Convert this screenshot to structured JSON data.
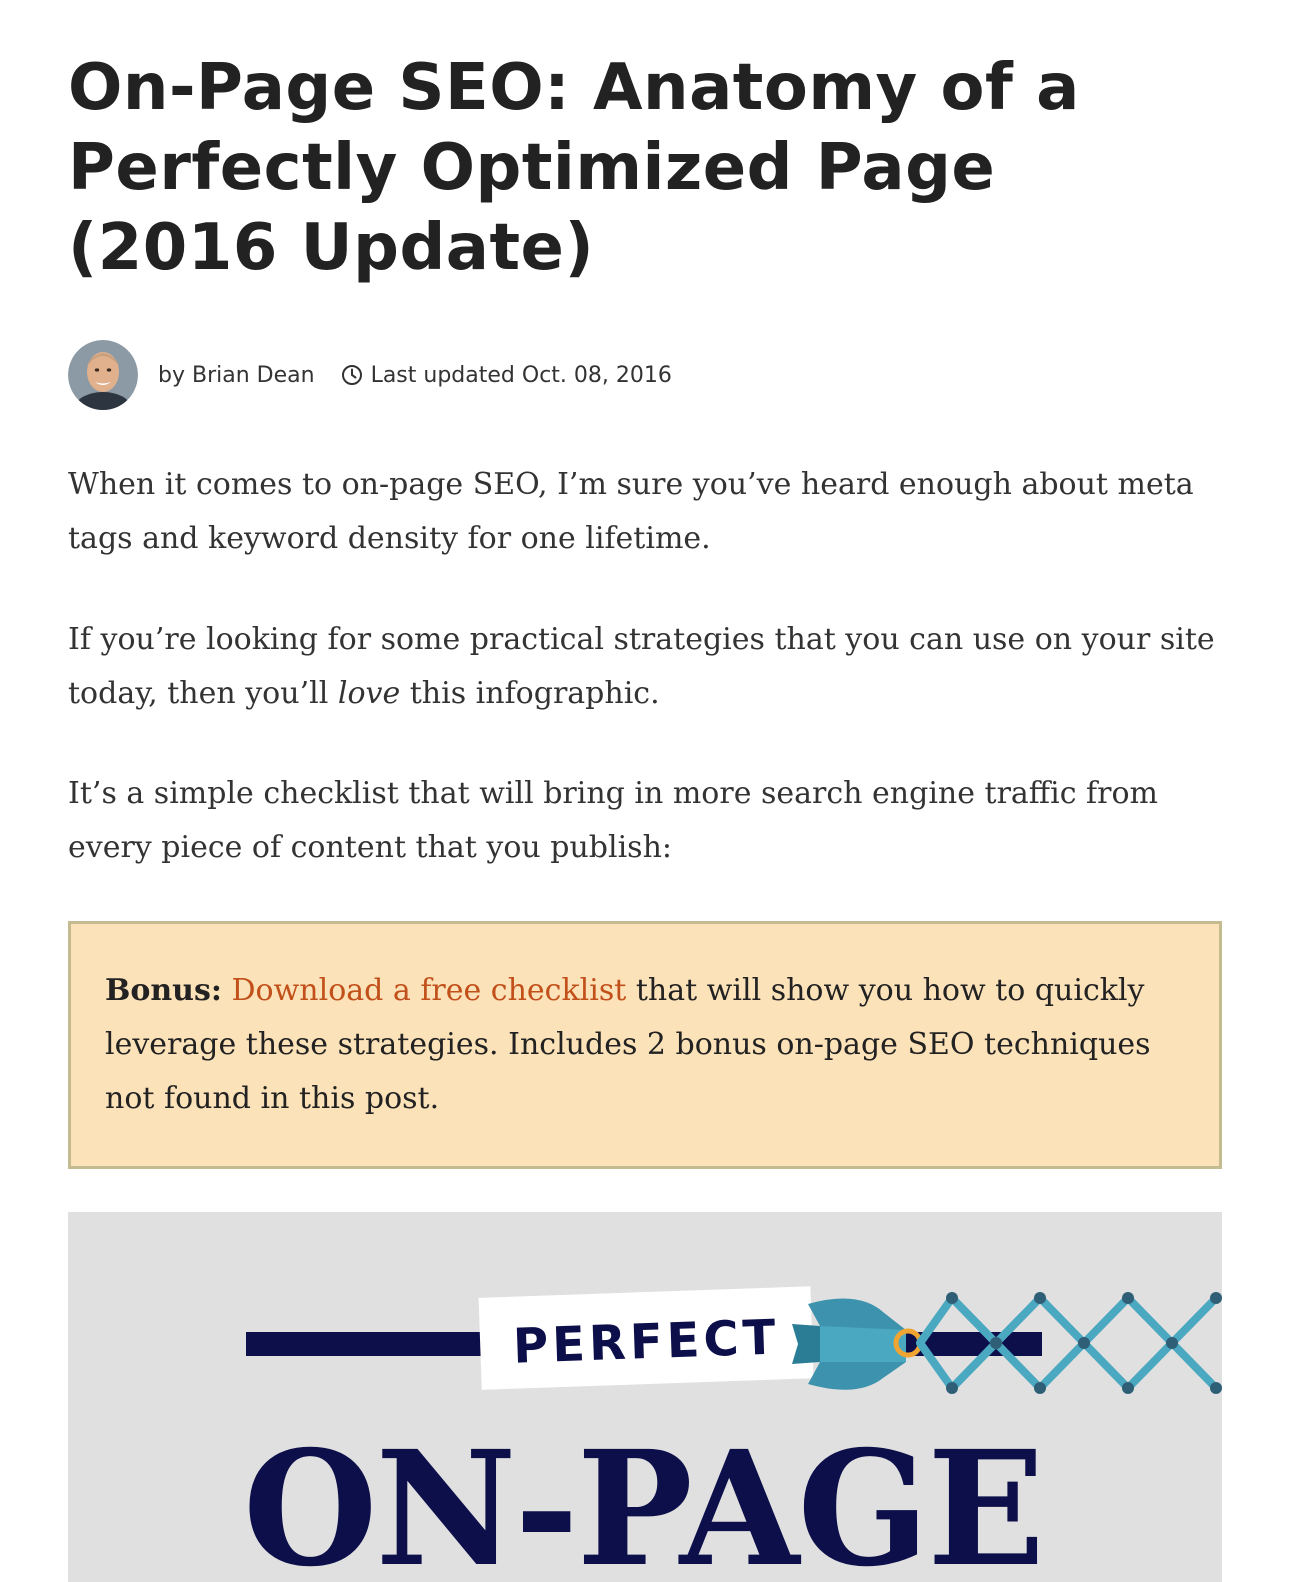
{
  "article": {
    "title": "On-Page SEO: Anatomy of a Perfectly Optimized Page (2016 Update)",
    "author_prefix": "by",
    "author_name": "Brian Dean",
    "updated_prefix": "Last updated",
    "updated_date": "Oct. 08, 2016",
    "paragraphs": {
      "p1": "When it comes to on-page SEO, I’m sure you’ve heard enough about meta tags and keyword density for one lifetime.",
      "p2_start": "If you’re looking for some practical strategies that you can use on your site today, then you’ll",
      "p2_emphasis": "love",
      "p2_end": "this infographic.",
      "p3": "It’s a simple checklist that will bring in more search engine traffic from every piece of content that you publish:"
    },
    "bonus": {
      "label": "Bonus:",
      "link_text": "Download a free checklist",
      "text": "that will show you how to quickly leverage these strategies. Includes 2 bonus on-page SEO techniques not found in this post."
    },
    "infographic": {
      "tag_text": "PERFECT",
      "headline": "ON-PAGE"
    }
  },
  "colors": {
    "title": "#222222",
    "body_text": "#333333",
    "bonus_bg": "#fce2b9",
    "bonus_border": "#c5bb91",
    "link": "#c1501a",
    "infographic_bg": "#e0e0e0",
    "infographic_navy": "#0d0f4a",
    "infographic_teal": "#4aa8c0",
    "infographic_orange": "#f0a532"
  },
  "icons": {
    "clock": "clock-icon",
    "avatar": "author-avatar"
  }
}
